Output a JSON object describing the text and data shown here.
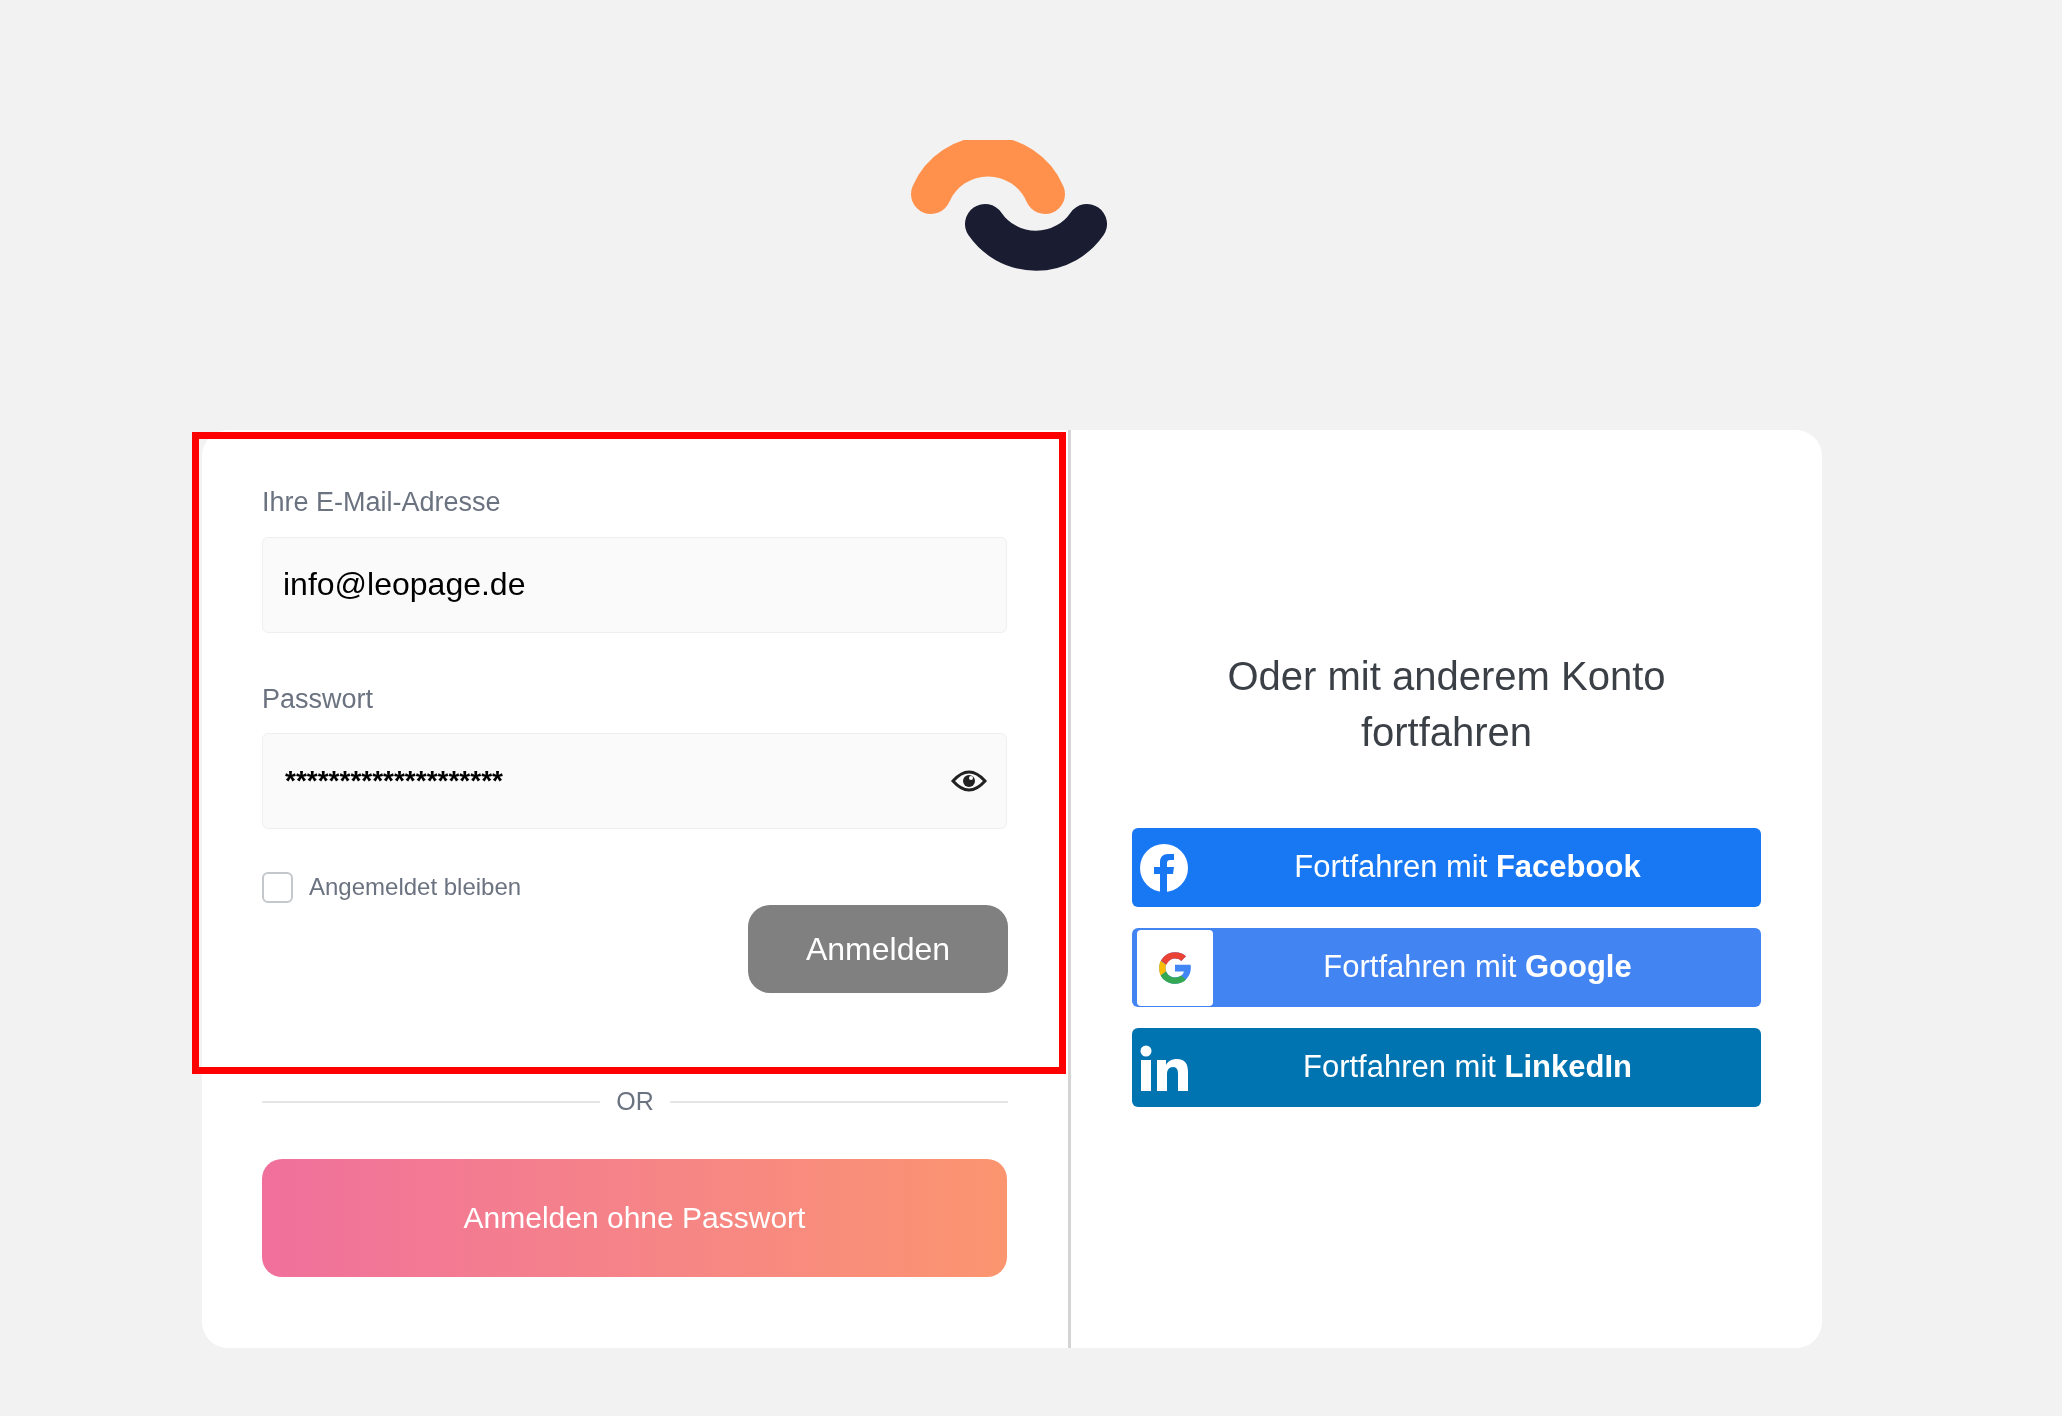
{
  "login_form": {
    "email": {
      "label": "Ihre E-Mail-Adresse",
      "value": "info@leopage.de"
    },
    "password": {
      "label": "Passwort",
      "value": "********************"
    },
    "remember": {
      "label": "Angemeldet bleiben",
      "checked": false
    },
    "submit": "Anmelden",
    "highlighted": true
  },
  "divider": "OR",
  "passwordless_button": "Anmelden ohne Passwort",
  "social": {
    "heading": "Oder mit anderem Konto fortfahren",
    "buttons": [
      {
        "kind": "facebook",
        "label": "Fortfahren mit **Facebook**"
      },
      {
        "kind": "google",
        "label": "Fortfahren mit **Google**"
      },
      {
        "kind": "linkedin",
        "label": "Fortfahren mit **LinkedIn**"
      }
    ]
  }
}
